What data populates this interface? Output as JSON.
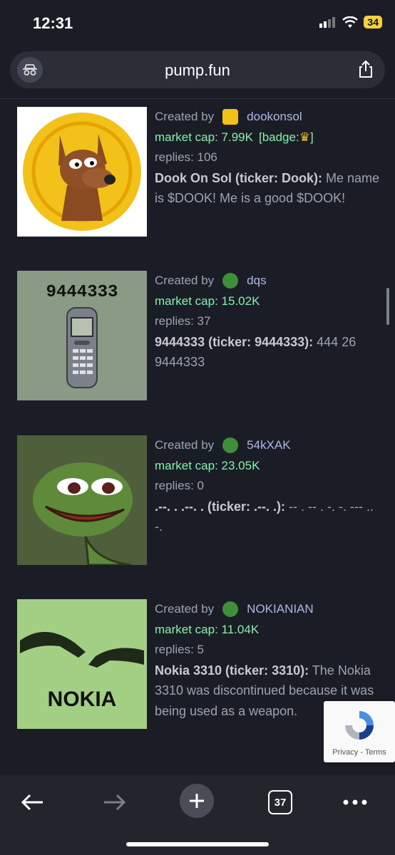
{
  "status": {
    "time": "12:31",
    "battery": "34"
  },
  "browser": {
    "domain": "pump.fun",
    "tabs_count": "37"
  },
  "feed": [
    {
      "created_by": "Created by",
      "username": "dookonsol",
      "market_cap": "market cap: 7.99K",
      "badge": "[badge:",
      "badge_end": "]",
      "replies": "replies: 106",
      "title": "Dook On Sol (ticker: Dook):",
      "description": " Me name is $DOOK! Me is a good $DOOK!"
    },
    {
      "created_by": "Created by",
      "username": "dqs",
      "market_cap": "market cap: 15.02K",
      "replies": "replies: 37",
      "title": "9444333 (ticker: 9444333):",
      "description": " 444 26 9444333",
      "image_text": "9444333"
    },
    {
      "created_by": "Created by",
      "username": "54kXAK",
      "market_cap": "market cap: 23.05K",
      "replies": "replies: 0",
      "title": ".--. . .--. . (ticker: .--. .):",
      "description": " -- . -- . -. -. --- .. -."
    },
    {
      "created_by": "Created by",
      "username": "NOKIANIAN",
      "market_cap": "market cap: 11.04K",
      "replies": "replies: 5",
      "title": "Nokia 3310 (ticker: 3310):",
      "description": " The Nokia 3310 was discontinued because it was being used as a weapon.",
      "image_text": "NOKIA"
    }
  ],
  "recaptcha": {
    "privacy": "Privacy",
    "sep": " - ",
    "terms": "Terms"
  }
}
